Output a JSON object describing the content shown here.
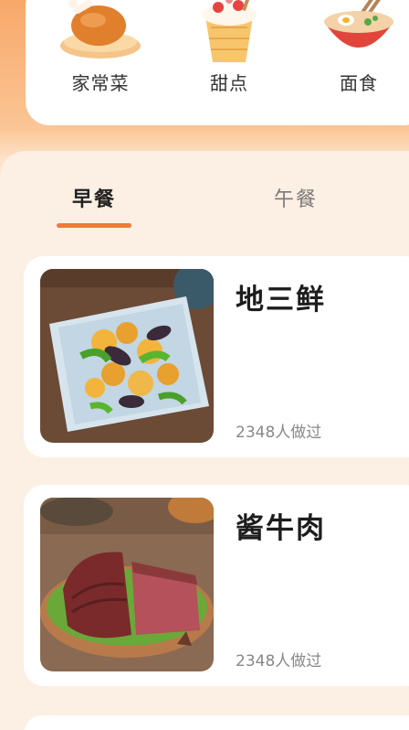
{
  "categories": [
    {
      "label": "家常菜",
      "icon": "roast-chicken-icon"
    },
    {
      "label": "甜点",
      "icon": "dessert-cup-icon"
    },
    {
      "label": "面食",
      "icon": "noodle-bowl-icon"
    }
  ],
  "tabs": [
    {
      "label": "早餐",
      "active": true
    },
    {
      "label": "午餐",
      "active": false
    }
  ],
  "recipes": [
    {
      "title": "地三鲜",
      "count": "2348人做过"
    },
    {
      "title": "酱牛肉",
      "count": "2348人做过"
    }
  ],
  "colors": {
    "accent": "#f07a3a",
    "header_gradient_top": "#f7a86a",
    "panel_bg": "#fcefe3"
  }
}
